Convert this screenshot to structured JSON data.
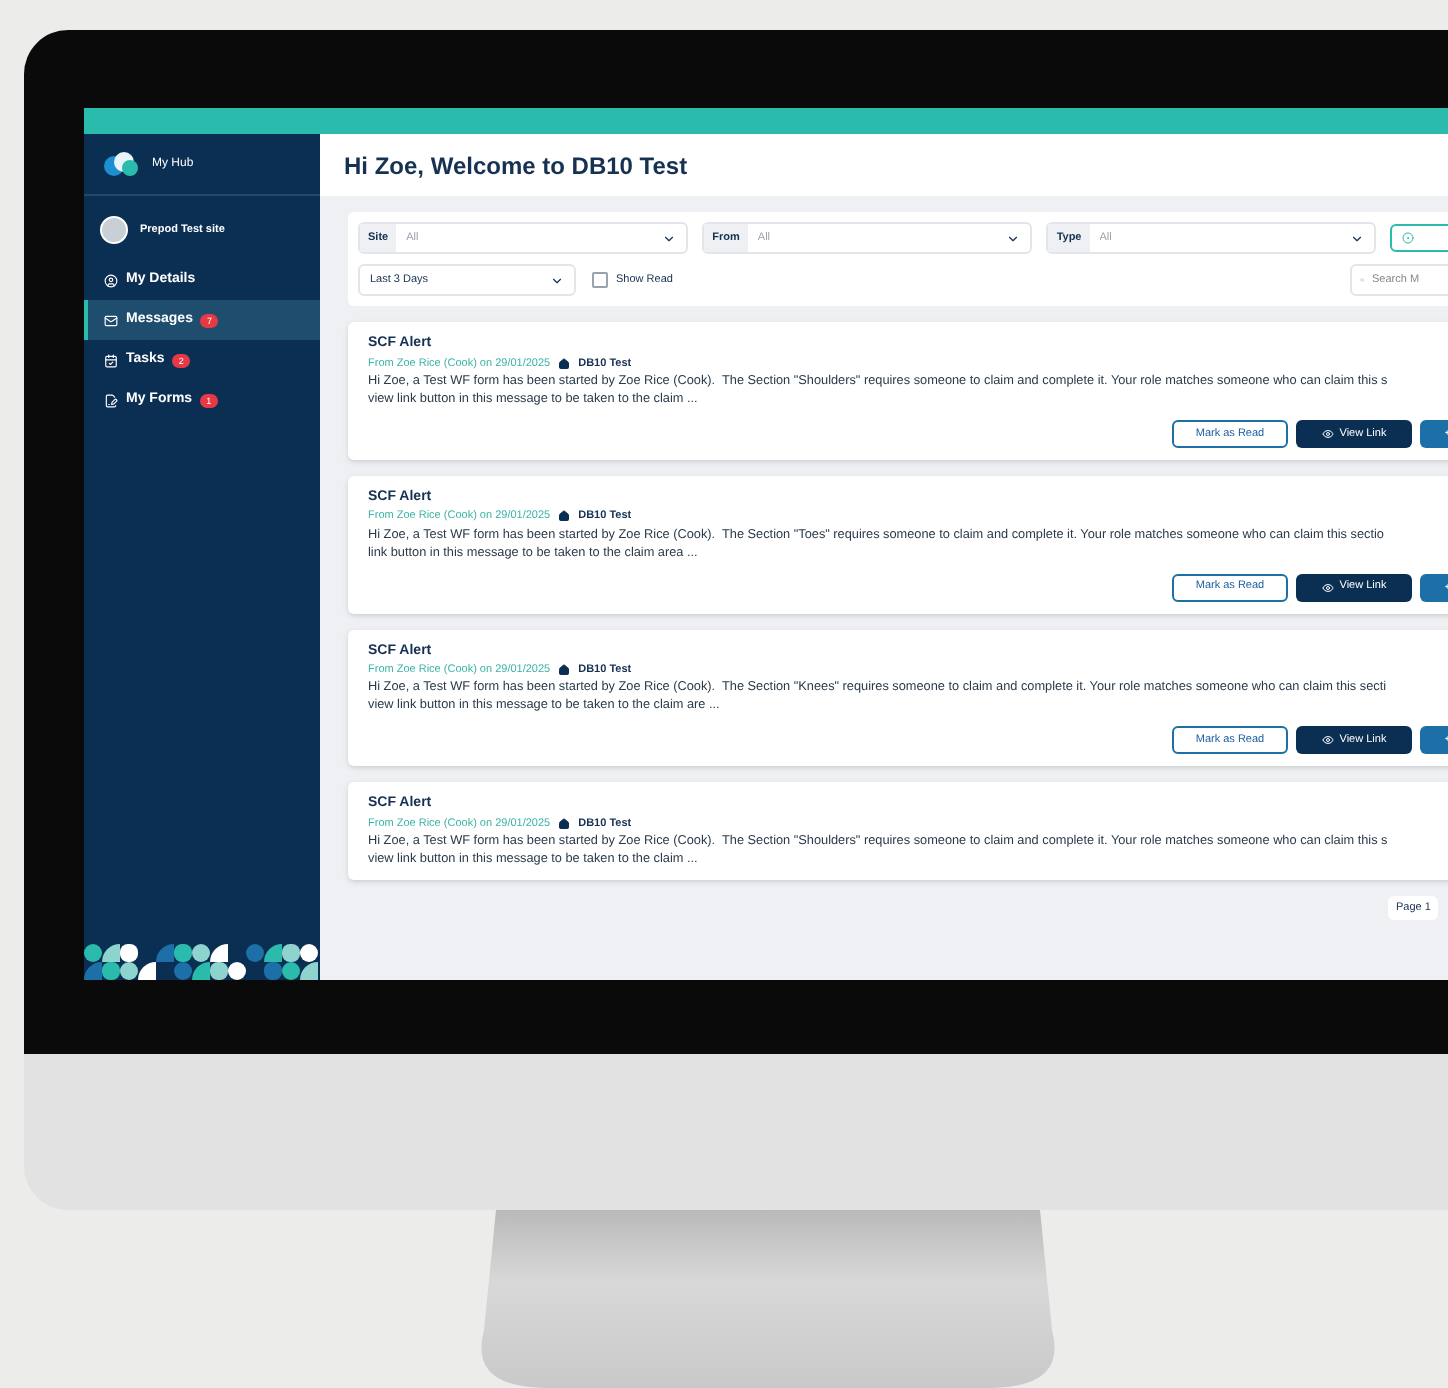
{
  "sidebar": {
    "brand": "My Hub",
    "site": "Prepod Test site",
    "items": [
      {
        "label": "My Details",
        "kind": "profile",
        "selected": false
      },
      {
        "label": "Messages",
        "kind": "inbox",
        "badge": "7",
        "selected": true
      },
      {
        "label": "Tasks",
        "kind": "tasks",
        "badge": "2",
        "selected": false
      },
      {
        "label": "My Forms",
        "kind": "forms",
        "badge": "1",
        "selected": false
      }
    ]
  },
  "header": {
    "title": "Hi Zoe, Welcome to DB10 Test"
  },
  "filters": {
    "selects": [
      {
        "label": "Site",
        "placeholder": "All"
      },
      {
        "label": "From",
        "placeholder": "All"
      },
      {
        "label": "Type",
        "placeholder": "All"
      }
    ],
    "period": {
      "value": "Last 3 Days"
    },
    "show_read": {
      "label": "Show Read",
      "checked": false
    },
    "search": {
      "placeholder": "Search M"
    }
  },
  "messages": [
    {
      "title": "SCF Alert",
      "from": "From Zoe Rice (Cook) on 29/01/2025",
      "org": "DB10 Test",
      "body_lines": [
        "Hi Zoe, a Test WF form has been started by Zoe Rice (Cook).  The Section \"Shoulders\" requires someone to claim and complete it. Your role matches someone who can claim this s",
        "view link button in this message to be taken to the claim ..."
      ],
      "buttons": [
        {
          "kind": "outline",
          "label": "Mark as Read"
        },
        {
          "kind": "dark",
          "label": "View Link"
        },
        {
          "kind": "primary"
        }
      ]
    },
    {
      "title": "SCF Alert",
      "from": "From Zoe Rice (Cook) on 29/01/2025",
      "org": "DB10 Test",
      "body_lines": [
        "Hi Zoe, a Test WF form has been started by Zoe Rice (Cook).  The Section \"Toes\" requires someone to claim and complete it. Your role matches someone who can claim this sectio",
        "link button in this message to be taken to the claim area ..."
      ],
      "buttons": [
        {
          "kind": "outline",
          "label": "Mark as Read"
        },
        {
          "kind": "dark",
          "label": "View Link"
        },
        {
          "kind": "primary"
        }
      ]
    },
    {
      "title": "SCF Alert",
      "from": "From Zoe Rice (Cook) on 29/01/2025",
      "org": "DB10 Test",
      "body_lines": [
        "Hi Zoe, a Test WF form has been started by Zoe Rice (Cook).  The Section \"Knees\" requires someone to claim and complete it. Your role matches someone who can claim this secti",
        "view link button in this message to be taken to the claim are ..."
      ],
      "buttons": [
        {
          "kind": "outline",
          "label": "Mark as Read"
        },
        {
          "kind": "dark",
          "label": "View Link"
        },
        {
          "kind": "primary"
        }
      ]
    },
    {
      "title": "SCF Alert",
      "from": "From Zoe Rice (Cook) on 29/01/2025",
      "org": "DB10 Test",
      "body_lines": [
        "Hi Zoe, a Test WF form has been started by Zoe Rice (Cook).  The Section \"Shoulders\" requires someone to claim and complete it. Your role matches someone who can claim this s",
        "view link button in this message to be taken to the claim ..."
      ]
    }
  ],
  "pagination": {
    "label": "Page 1"
  }
}
